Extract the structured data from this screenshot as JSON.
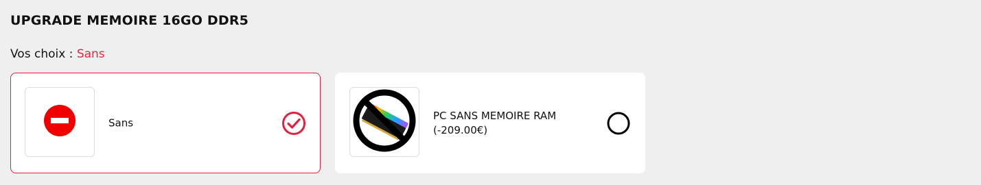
{
  "section": {
    "title": "UPGRADE MEMOIRE 16GO DDR5",
    "choice_label": "Vos choix :",
    "choice_value": "Sans"
  },
  "options": [
    {
      "label": "Sans",
      "price": "",
      "selected": true,
      "icon": "no-entry-icon"
    },
    {
      "label": "PC SANS MEMOIRE RAM",
      "price": "(-209.00€)",
      "selected": false,
      "icon": "no-ram-icon"
    }
  ],
  "colors": {
    "accent": "#e2203d",
    "background": "#efefef",
    "card": "#ffffff",
    "stop_red": "#f00000"
  }
}
